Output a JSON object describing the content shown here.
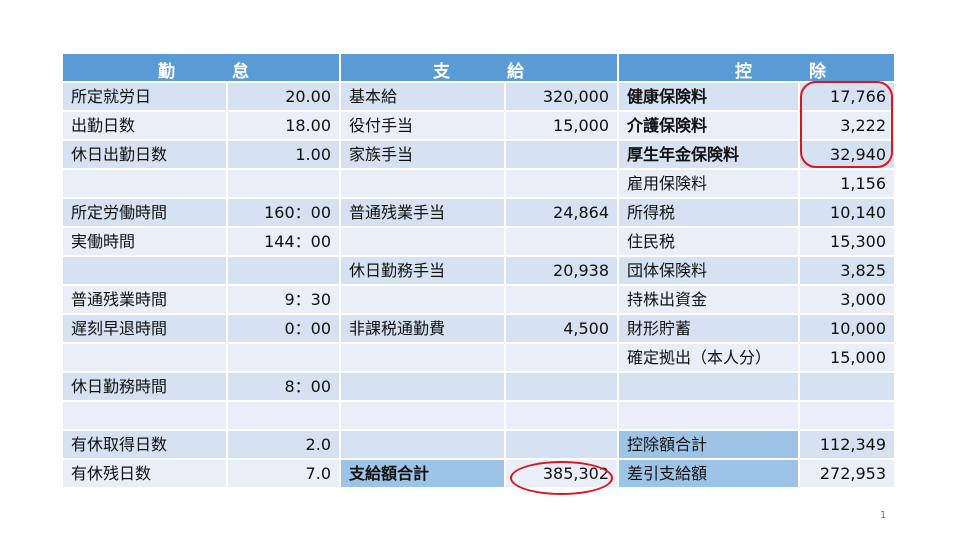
{
  "headers": {
    "attendance": [
      "勤",
      "怠"
    ],
    "payment": [
      "支",
      "給"
    ],
    "deduction": [
      "控",
      "除"
    ]
  },
  "attendance": [
    {
      "label": "所定就労日",
      "value": "20.00"
    },
    {
      "label": "出勤日数",
      "value": "18.00"
    },
    {
      "label": "休日出勤日数",
      "value": "1.00"
    },
    {
      "label": "",
      "value": ""
    },
    {
      "label": "所定労働時間",
      "value": "160：00"
    },
    {
      "label": "実働時間",
      "value": "144：00"
    },
    {
      "label": "",
      "value": ""
    },
    {
      "label": "普通残業時間",
      "value": "9：30"
    },
    {
      "label": "遅刻早退時間",
      "value": "0：00"
    },
    {
      "label": "",
      "value": ""
    },
    {
      "label": "休日勤務時間",
      "value": "8：00"
    },
    {
      "label": "",
      "value": ""
    },
    {
      "label": "有休取得日数",
      "value": "2.0"
    },
    {
      "label": "有休残日数",
      "value": "7.0"
    }
  ],
  "payment": [
    {
      "label": "基本給",
      "value": "320,000"
    },
    {
      "label": "役付手当",
      "value": "15,000"
    },
    {
      "label": "家族手当",
      "value": ""
    },
    {
      "label": "",
      "value": ""
    },
    {
      "label": "普通残業手当",
      "value": "24,864"
    },
    {
      "label": "",
      "value": ""
    },
    {
      "label": "休日勤務手当",
      "value": "20,938"
    },
    {
      "label": "",
      "value": ""
    },
    {
      "label": "非課税通勤費",
      "value": "4,500"
    },
    {
      "label": "",
      "value": ""
    },
    {
      "label": "",
      "value": ""
    },
    {
      "label": "",
      "value": ""
    },
    {
      "label": "",
      "value": ""
    },
    {
      "label": "支給額合計",
      "value": "385,302"
    }
  ],
  "deduction": [
    {
      "label": "健康保険料",
      "value": "17,766"
    },
    {
      "label": "介護保険料",
      "value": "3,222"
    },
    {
      "label": "厚生年金保険料",
      "value": "32,940"
    },
    {
      "label": "雇用保険料",
      "value": "1,156"
    },
    {
      "label": "所得税",
      "value": "10,140"
    },
    {
      "label": "住民税",
      "value": "15,300"
    },
    {
      "label": "団体保険料",
      "value": "3,825"
    },
    {
      "label": "持株出資金",
      "value": "3,000"
    },
    {
      "label": "財形貯蓄",
      "value": "10,000"
    },
    {
      "label": "確定拠出（本人分）",
      "value": "15,000"
    },
    {
      "label": "",
      "value": ""
    },
    {
      "label": "",
      "value": ""
    },
    {
      "label": "控除額合計",
      "value": "112,349"
    },
    {
      "label": "差引支給額",
      "value": "272,953"
    }
  ],
  "page_number": "1",
  "colors": {
    "header_bg": "#5b9bd5",
    "row_a": "#d6e1f2",
    "row_b": "#e9eef8",
    "highlight": "#9dc3e6",
    "annotation": "#e0141e"
  }
}
